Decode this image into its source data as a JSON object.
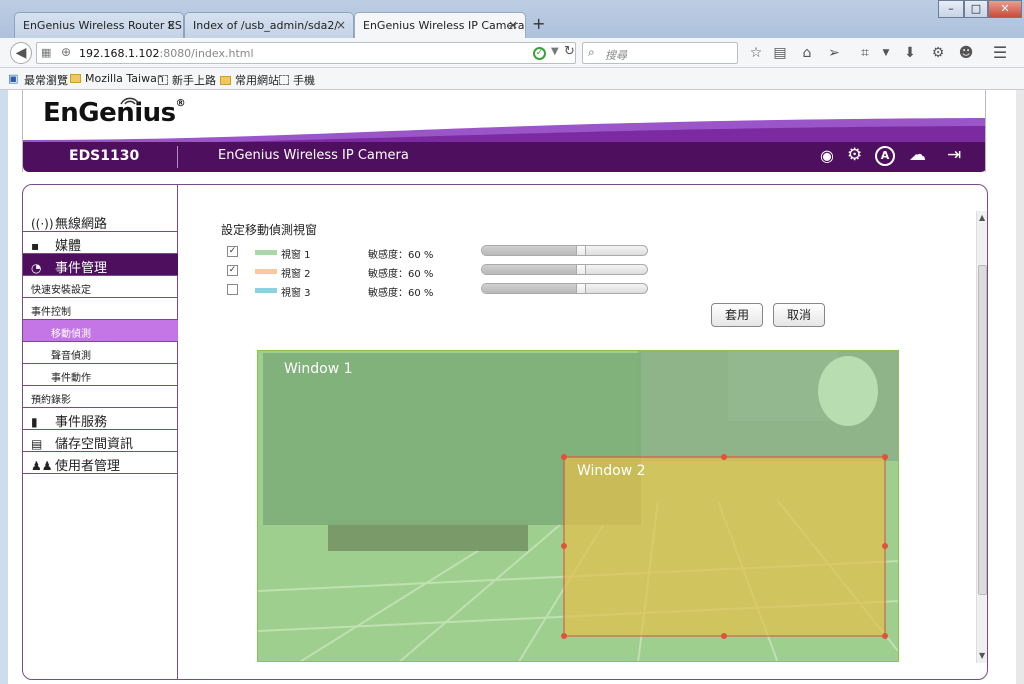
{
  "browser": {
    "tabs": [
      {
        "title": "EnGenius Wireless Router ES...",
        "active": false
      },
      {
        "title": "Index of /usb_admin/sda2/",
        "active": false
      },
      {
        "title": "EnGenius Wireless IP Camera",
        "active": true
      }
    ],
    "url": "192.168.1.102:8080/index.html",
    "url_host": "192.168.1.102",
    "url_rest": ":8080/index.html",
    "search_placeholder": "搜尋",
    "bookmarks": [
      "最常瀏覽",
      "Mozilla Taiwan",
      "新手上路",
      "常用網站",
      "手機"
    ]
  },
  "header": {
    "logo": "EnGenius",
    "model": "EDS1130",
    "product": "EnGenius Wireless IP Camera"
  },
  "sidebar": {
    "items": [
      {
        "label": "無線網路",
        "icon": "antenna-icon",
        "level": 0
      },
      {
        "label": "媒體",
        "icon": "media-icon",
        "level": 0
      },
      {
        "label": "事件管理",
        "icon": "event-icon",
        "level": 0,
        "active": true
      },
      {
        "label": "快速安裝設定",
        "level": 1
      },
      {
        "label": "事件控制",
        "level": 1
      },
      {
        "label": "移動偵測",
        "level": 2,
        "selected": true
      },
      {
        "label": "聲音偵測",
        "level": 2
      },
      {
        "label": "事件動作",
        "level": 2
      },
      {
        "label": "預約錄影",
        "level": 1
      },
      {
        "label": "事件服務",
        "icon": "sd-icon",
        "level": 0
      },
      {
        "label": "儲存空間資訊",
        "icon": "storage-icon",
        "level": 0
      },
      {
        "label": "使用者管理",
        "icon": "users-icon",
        "level": 0
      }
    ]
  },
  "main": {
    "title": "設定移動偵測視窗",
    "windows": [
      {
        "label": "視窗 1",
        "checked": true,
        "color": "#a8d8a8",
        "sensitivity_label": "敏感度：60 %",
        "sensitivity": 60
      },
      {
        "label": "視窗 2",
        "checked": true,
        "color": "#f8c8a0",
        "sensitivity_label": "敏感度：60 %",
        "sensitivity": 60
      },
      {
        "label": "視窗 3",
        "checked": false,
        "color": "#90d0e0",
        "sensitivity_label": "敏感度：60 %",
        "sensitivity": 60
      }
    ],
    "apply": "套用",
    "cancel": "取消",
    "overlay1": "Window 1",
    "overlay2": "Window 2"
  },
  "colors": {
    "brand_purple": "#4e0f5e",
    "selected_purple": "#c476e6",
    "window1": "#7fb87a",
    "window2": "#e6c04a"
  }
}
